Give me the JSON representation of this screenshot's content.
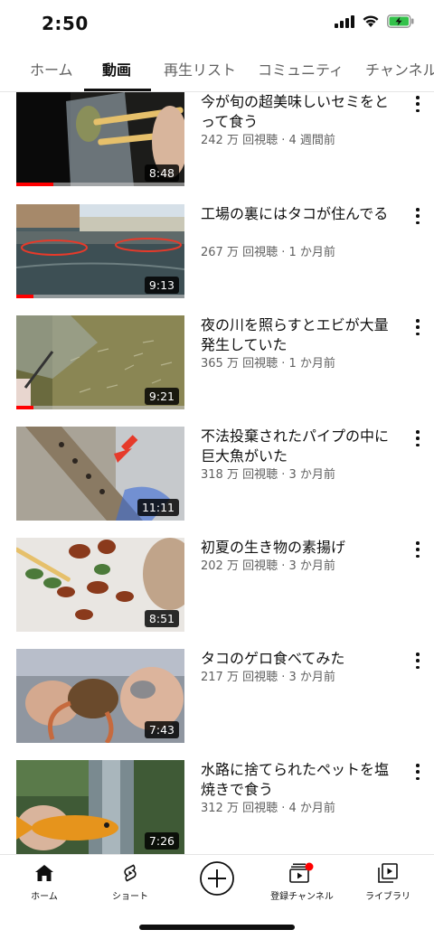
{
  "status": {
    "time": "2:50"
  },
  "tabs": [
    {
      "label": "ホーム",
      "active": false
    },
    {
      "label": "動画",
      "active": true
    },
    {
      "label": "再生リスト",
      "active": false
    },
    {
      "label": "コミュニティ",
      "active": false
    },
    {
      "label": "チャンネル",
      "active": false
    }
  ],
  "videos": [
    {
      "title": "今が旬の超美味しいセミをとって食う",
      "meta": "242 万 回視聴 · 4 週間前",
      "duration": "8:48",
      "watched": 0.22
    },
    {
      "title": "工場の裏にはタコが住んでる",
      "meta": "267 万 回視聴 · 1 か月前",
      "duration": "9:13",
      "watched": 0.1
    },
    {
      "title": "夜の川を照らすとエビが大量発生していた",
      "meta": "365 万 回視聴 · 1 か月前",
      "duration": "9:21",
      "watched": 0.1
    },
    {
      "title": "不法投棄されたパイプの中に巨大魚がいた",
      "meta": "318 万 回視聴 · 3 か月前",
      "duration": "11:11",
      "watched": 0
    },
    {
      "title": "初夏の生き物の素揚げ",
      "meta": "202 万 回視聴 · 3 か月前",
      "duration": "8:51",
      "watched": 0
    },
    {
      "title": "タコのゲロ食べてみた",
      "meta": "217 万 回視聴 · 3 か月前",
      "duration": "7:43",
      "watched": 0
    },
    {
      "title": "水路に捨てられたペットを塩焼きで食う",
      "meta": "312 万 回視聴 · 4 か月前",
      "duration": "7:26",
      "watched": 0
    }
  ],
  "bottom_nav": [
    {
      "label": "ホーム",
      "icon": "home-icon"
    },
    {
      "label": "ショート",
      "icon": "shorts-icon"
    },
    {
      "label": "",
      "icon": "create-plus-icon"
    },
    {
      "label": "登録チャンネル",
      "icon": "subscriptions-icon"
    },
    {
      "label": "ライブラリ",
      "icon": "library-icon"
    }
  ],
  "colors": {
    "accent": "#ff0000",
    "text": "#0f0f0f",
    "meta": "#606060"
  }
}
